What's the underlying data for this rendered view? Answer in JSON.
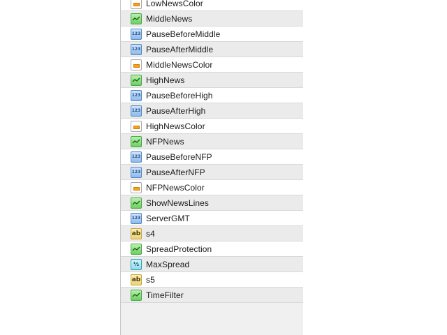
{
  "parameters": [
    {
      "type": "color",
      "icon": "color-swatch-icon",
      "label": "LowNewsColor"
    },
    {
      "type": "bool",
      "icon": "bool-icon",
      "label": "MiddleNews"
    },
    {
      "type": "int",
      "icon": "int-123-icon",
      "label": "PauseBeforeMiddle"
    },
    {
      "type": "int",
      "icon": "int-123-icon",
      "label": "PauseAfterMiddle"
    },
    {
      "type": "color",
      "icon": "color-swatch-icon",
      "label": "MiddleNewsColor"
    },
    {
      "type": "bool",
      "icon": "bool-icon",
      "label": "HighNews"
    },
    {
      "type": "int",
      "icon": "int-123-icon",
      "label": "PauseBeforeHigh"
    },
    {
      "type": "int",
      "icon": "int-123-icon",
      "label": "PauseAfterHigh"
    },
    {
      "type": "color",
      "icon": "color-swatch-icon",
      "label": "HighNewsColor"
    },
    {
      "type": "bool",
      "icon": "bool-icon",
      "label": "NFPNews"
    },
    {
      "type": "int",
      "icon": "int-123-icon",
      "label": "PauseBeforeNFP"
    },
    {
      "type": "int",
      "icon": "int-123-icon",
      "label": "PauseAfterNFP"
    },
    {
      "type": "color",
      "icon": "color-swatch-icon",
      "label": "NFPNewsColor"
    },
    {
      "type": "bool",
      "icon": "bool-icon",
      "label": "ShowNewsLines"
    },
    {
      "type": "int",
      "icon": "int-123-icon",
      "label": "ServerGMT"
    },
    {
      "type": "string",
      "icon": "string-ab-icon",
      "label": "s4"
    },
    {
      "type": "bool",
      "icon": "bool-icon",
      "label": "SpreadProtection"
    },
    {
      "type": "double",
      "icon": "double-half-icon",
      "label": "MaxSpread"
    },
    {
      "type": "string",
      "icon": "string-ab-icon",
      "label": "s5"
    },
    {
      "type": "bool",
      "icon": "bool-icon",
      "label": "TimeFilter"
    }
  ]
}
